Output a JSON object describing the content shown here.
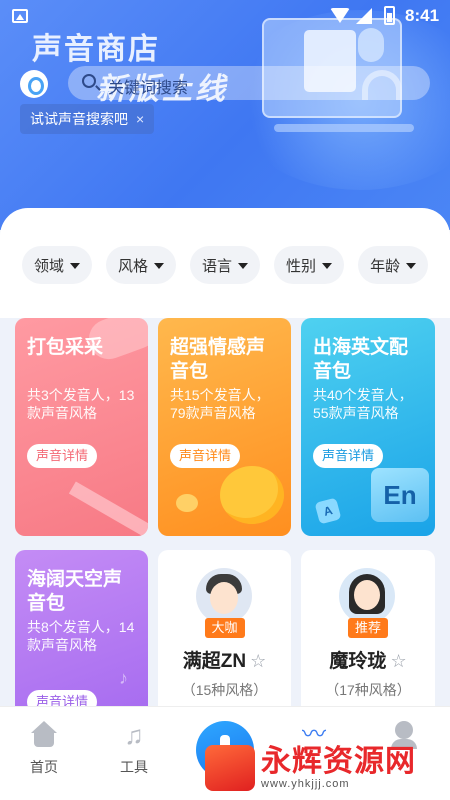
{
  "status_bar": {
    "time": "8:41"
  },
  "header": {
    "title": "声音商店",
    "banner_text": "新版上线",
    "search_placeholder": "关键词搜索",
    "hint_chip": "试试声音搜索吧",
    "hint_close": "×"
  },
  "filters": [
    {
      "label": "领域"
    },
    {
      "label": "风格"
    },
    {
      "label": "语言"
    },
    {
      "label": "性别"
    },
    {
      "label": "年龄"
    }
  ],
  "packs": [
    {
      "title": "打包采采",
      "desc": "共3个发音人，13款声音风格",
      "button": "声音详情",
      "button_color": "#f46b77"
    },
    {
      "title": "超强情感声音包",
      "desc": "共15个发音人，79款声音风格",
      "button": "声音详情",
      "button_color": "#ff8a1a"
    },
    {
      "title": "出海英文配音包",
      "desc": "共40个发音人，55款声音风格",
      "button": "声音详情",
      "button_color": "#1a9be0",
      "tile_text": "En",
      "tile_small": "A"
    },
    {
      "title": "海阔天空声音包",
      "desc": "共8个发音人，14款声音风格",
      "button": "声音详情",
      "button_color": "#9a5fe8"
    }
  ],
  "voices": [
    {
      "badge": "大咖",
      "name": "满超ZN",
      "styles": "（15种风格）"
    },
    {
      "badge": "推荐",
      "name": "魔玲珑",
      "styles": "（17种风格）"
    }
  ],
  "bottom_nav": {
    "home": "首页",
    "tools": "工具"
  },
  "watermark": {
    "title": "永辉资源网",
    "url": "www.yhkjjj.com"
  }
}
